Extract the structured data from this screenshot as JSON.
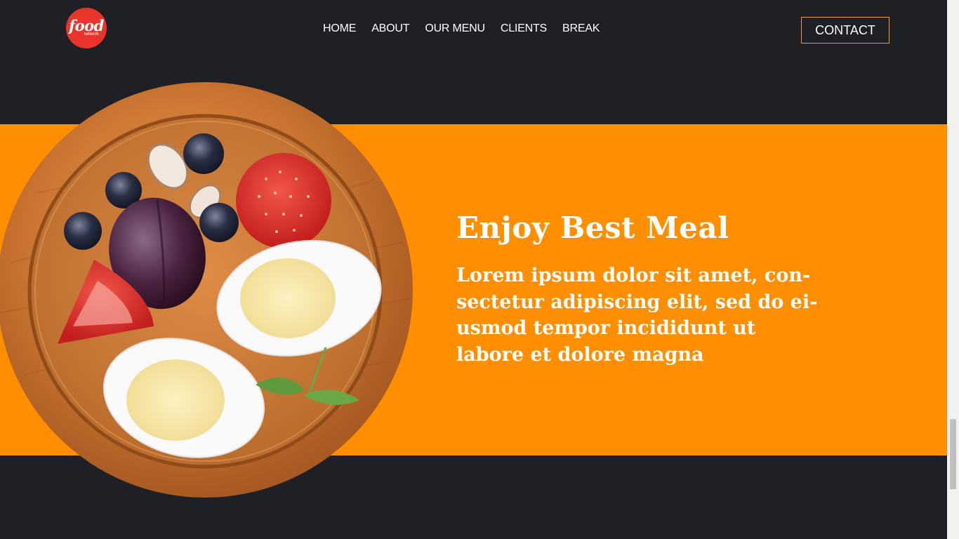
{
  "logo": {
    "word": "food",
    "sub": "network"
  },
  "nav": {
    "items": [
      {
        "label": "HOME"
      },
      {
        "label": "ABOUT"
      },
      {
        "label": "OUR MENU"
      },
      {
        "label": "CLIENTS"
      },
      {
        "label": "BREAK"
      }
    ],
    "contact_label": "CONTACT"
  },
  "hero": {
    "title": "Enjoy Best Meal",
    "body": "Lorem ipsum dolor sit amet, con-sectetur adipiscing elit, sed do ei-usmod tempor incididunt ut labore et dolore magna"
  },
  "colors": {
    "background": "#1f1f26",
    "band": "#ff8f00",
    "logo": "#e9342b",
    "contact_border": "#ff9a1f"
  }
}
